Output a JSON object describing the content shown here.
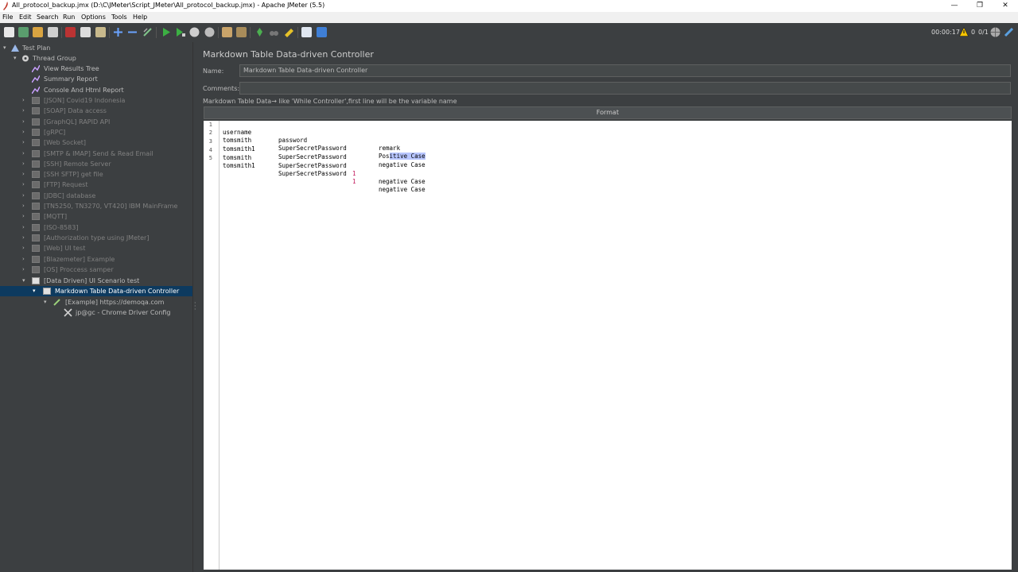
{
  "window": {
    "title": "All_protocol_backup.jmx (D:\\C\\JMeter\\Script_JMeter\\All_protocol_backup.jmx) - Apache JMeter (5.5)",
    "minimize": "—",
    "restore": "❐",
    "close": "✕"
  },
  "menu": [
    "File",
    "Edit",
    "Search",
    "Run",
    "Options",
    "Tools",
    "Help"
  ],
  "status": {
    "timer": "00:00:17",
    "warnings": "0",
    "threads": "0/1"
  },
  "tree": {
    "test_plan": "Test Plan",
    "thread_group": "Thread Group",
    "view_results_tree": "View Results Tree",
    "summary_report": "Summary Report",
    "console_html_report": "Console And Html Report",
    "disabled_items": [
      "[JSON] Covid19 Indonesia",
      "[SOAP] Data access",
      "[GraphQL] RAPID API",
      "[gRPC]",
      "[Web Socket]",
      "[SMTP & IMAP] Send & Read Email",
      "[SSH] Remote Server",
      "[SSH SFTP] get file",
      "[FTP] Request",
      "[JDBC] database",
      "[TN5250, TN3270, VT420] IBM MainFrame",
      "[MQTT]",
      "[ISO-8583]",
      "[Authorization type using JMeter]",
      "[Web] UI test",
      "[Blazemeter] Example",
      "[OS] Proccess samper"
    ],
    "data_driven": "[Data Driven] UI Scenario test",
    "markdown_controller": "Markdown Table Data-driven Controller",
    "example_demoqa": "[Example] https://demoqa.com",
    "chrome_driver": "jp@gc - Chrome Driver Config"
  },
  "panel": {
    "title": "Markdown Table Data-driven Controller",
    "name_label": "Name:",
    "name_value": "Markdown Table Data-driven Controller",
    "comments_label": "Comments:",
    "comments_value": "",
    "hint": "Markdown Table Data→ like 'While Controller',first line will be the variable name",
    "format_button": "Format"
  },
  "editor": {
    "lines": [
      {
        "num": "1",
        "c1": "username",
        "c2": "password",
        "pipe": "",
        "c3": "remark"
      },
      {
        "num": "2",
        "c1": "tomsmith",
        "c2": "SuperSecretPassword",
        "pipe": "",
        "c3_pre": "Pos",
        "c3_sel": "itive Case"
      },
      {
        "num": "3",
        "c1": "tomsmith1",
        "c2": "SuperSecretPassword",
        "pipe": "",
        "c3": "negative Case"
      },
      {
        "num": "4",
        "c1": "tomsmith",
        "c2": "SuperSecretPassword",
        "pipe": "1",
        "c3": "negative Case"
      },
      {
        "num": "5",
        "c1": "tomsmith1",
        "c2": "SuperSecretPassword",
        "pipe": "1",
        "c3": "negative Case"
      }
    ]
  },
  "colors": {
    "background": "#3c3f41",
    "selected_node": "#0d3a5f",
    "text_selection": "#b8c6ff",
    "start_button": "#3cb043",
    "warning": "#f5c400"
  }
}
